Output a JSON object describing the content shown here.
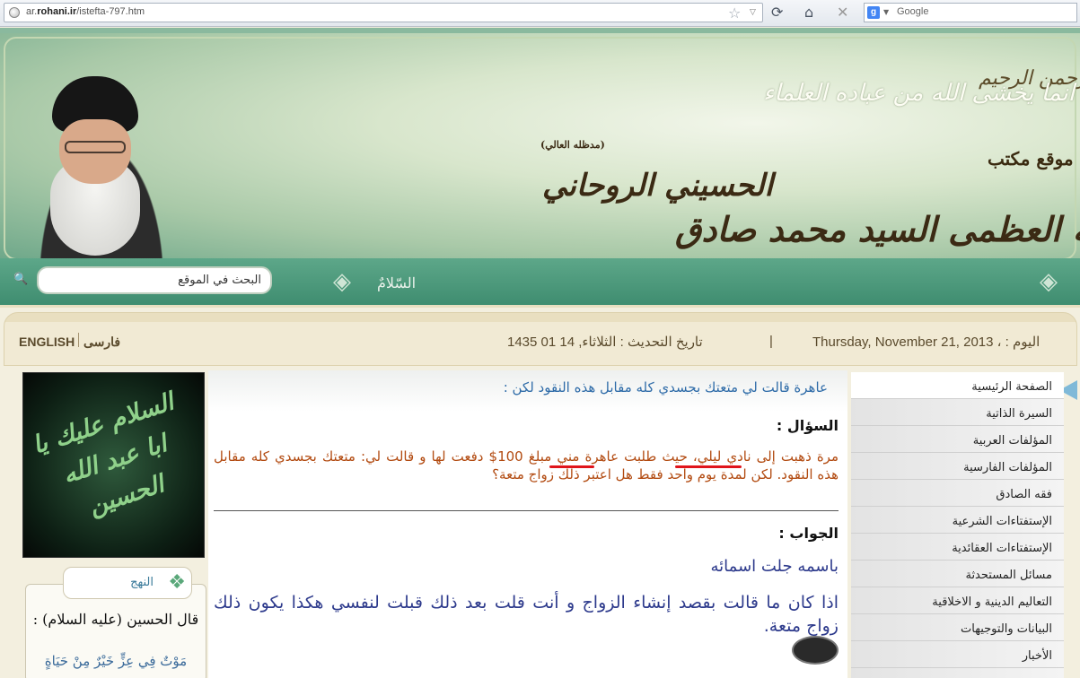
{
  "browser": {
    "url_prefix": "ar.",
    "url_domain": "rohani.ir",
    "url_path": "/istefta-797.htm",
    "search_placeholder": "Google",
    "search_engine_icon": "g-icon"
  },
  "banner": {
    "basmala": "بسم الله الرحمن الرحيم",
    "verse": "انما يخشى الله من عباده العلماء",
    "office_label": "موقع مكتب",
    "name_line1": "الحسيني الروحاني",
    "name_sub": "(مدظله العالي)",
    "name_line2": "سماحة آية الله العظمى السيد محمد صادق"
  },
  "nav": {
    "search_placeholder": "البحث في الموقع",
    "salam": "السّلامٌ"
  },
  "info": {
    "lang_english": "ENGLISH",
    "lang_farsi": "فارسی",
    "update": "تاريخ التحديث : الثلاثاء, 14 01 1435",
    "separator": "|",
    "today": "Thursday, November 21, 2013 ، : اليوم"
  },
  "left": {
    "poster_text": "السلام عليك يا ابا عبد الله الحسين",
    "nahj_tab": "النهج",
    "nahj_title": "قال الحسين (عليه السلام) :",
    "nahj_quote": "مَوْتٌ فِي عِزٍّ خَيْرٌ مِنْ حَيَاةٍ"
  },
  "main": {
    "title": "عاهرة قالت لي متعتك بجسدي كله مقابل هذه النقود لكن :",
    "question_label": "السؤال :",
    "question_text": "مرة ذهبت إلى نادي ليلي، حيث طلبت عاهرة مني مبلغ 100$ دفعت لها و قالت لي: متعتك بجسدي كله مقابل هذه النقود. لكن لمدة يوم واحد فقط هل اعتبر ذلك زواج متعة؟",
    "answer_label": "الجواب :",
    "answer_bism": "باسمه جلت اسمائه",
    "answer_text": "اذا كان ما قالت بقصد إنشاء الزواج و أنت قلت بعد ذلك قبلت لنفسي هكذا يكون ذلك زواج متعة.",
    "underline_color": "#e0141b"
  },
  "sidebar": {
    "items": [
      {
        "label": "الصفحة الرئيسية"
      },
      {
        "label": "السيرة الذاتية"
      },
      {
        "label": "المؤلفات العربية"
      },
      {
        "label": "المؤلفات الفارسية"
      },
      {
        "label": "فقه الصادق"
      },
      {
        "label": "الإستفتاءات الشرعية"
      },
      {
        "label": "الإستفتاءات العقائدية"
      },
      {
        "label": "مسائل المستحدثة"
      },
      {
        "label": "التعاليم الدينية و الاخلاقية"
      },
      {
        "label": "البيانات والتوجيهات"
      },
      {
        "label": "الأخبار"
      }
    ]
  }
}
